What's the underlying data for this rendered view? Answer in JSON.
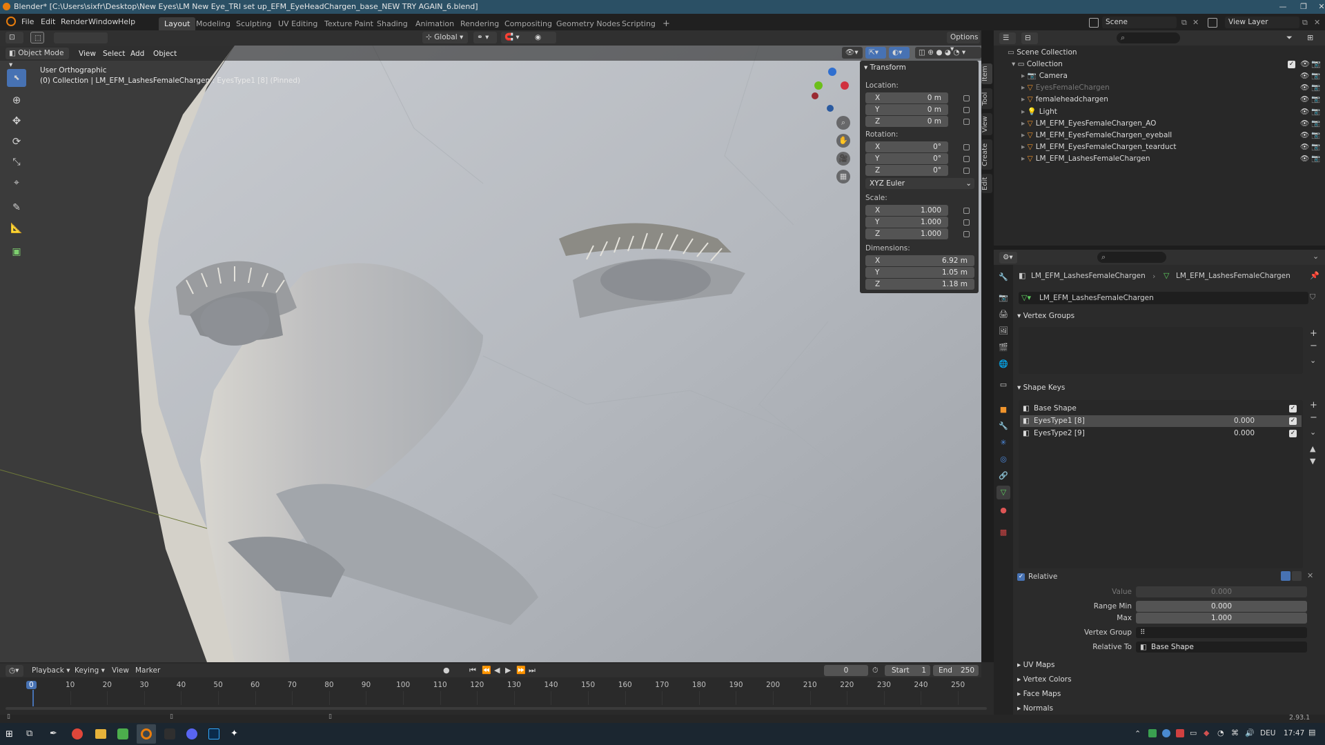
{
  "window": {
    "title": "Blender* [C:\\Users\\sixfr\\Desktop\\New Eyes\\LM New Eye_TRI set up_EFM_EyeHeadChargen_base_NEW TRY AGAIN_6.blend]"
  },
  "menu": [
    "File",
    "Edit",
    "Render",
    "Window",
    "Help"
  ],
  "workspaces": [
    "Layout",
    "Modeling",
    "Sculpting",
    "UV Editing",
    "Texture Paint",
    "Shading",
    "Animation",
    "Rendering",
    "Compositing",
    "Geometry Nodes",
    "Scripting"
  ],
  "scene": {
    "label": "Scene",
    "view_layer": "View Layer"
  },
  "viewport": {
    "mode": "Object Mode",
    "menus": [
      "View",
      "Select",
      "Add",
      "Object"
    ],
    "transform_orient": "Global",
    "options": "Options",
    "view_name": "User Orthographic",
    "context": "(0) Collection | LM_EFM_LashesFemaleChargen : EyesType1 [8] (Pinned)"
  },
  "npanel": {
    "title": "Transform",
    "tabs": [
      "Item",
      "Tool",
      "View",
      "Create",
      "Edit"
    ],
    "location_label": "Location:",
    "rotation_label": "Rotation:",
    "scale_label": "Scale:",
    "dimensions_label": "Dimensions:",
    "location": [
      {
        "k": "X",
        "v": "0 m"
      },
      {
        "k": "Y",
        "v": "0 m"
      },
      {
        "k": "Z",
        "v": "0 m"
      }
    ],
    "rotation": [
      {
        "k": "X",
        "v": "0°"
      },
      {
        "k": "Y",
        "v": "0°"
      },
      {
        "k": "Z",
        "v": "0°"
      }
    ],
    "rotation_mode": "XYZ Euler",
    "scale": [
      {
        "k": "X",
        "v": "1.000"
      },
      {
        "k": "Y",
        "v": "1.000"
      },
      {
        "k": "Z",
        "v": "1.000"
      }
    ],
    "dimensions": [
      {
        "k": "X",
        "v": "6.92 m"
      },
      {
        "k": "Y",
        "v": "1.05 m"
      },
      {
        "k": "Z",
        "v": "1.18 m"
      }
    ]
  },
  "outliner": {
    "root": "Scene Collection",
    "collection": "Collection",
    "items": [
      {
        "name": "Camera",
        "icon": "camera-icon"
      },
      {
        "name": "EyesFemaleChargen",
        "icon": "mesh-icon",
        "dim": true
      },
      {
        "name": "femaleheadchargen",
        "icon": "mesh-icon"
      },
      {
        "name": "Light",
        "icon": "light-icon"
      },
      {
        "name": "LM_EFM_EyesFemaleChargen_AO",
        "icon": "mesh-icon"
      },
      {
        "name": "LM_EFM_EyesFemaleChargen_eyeball",
        "icon": "mesh-icon"
      },
      {
        "name": "LM_EFM_EyesFemaleChargen_tearduct",
        "icon": "mesh-icon"
      },
      {
        "name": "LM_EFM_LashesFemaleChargen",
        "icon": "mesh-icon"
      }
    ]
  },
  "props": {
    "object": "LM_EFM_LashesFemaleChargen",
    "mesh": "LM_EFM_LashesFemaleChargen",
    "mesh_field": "LM_EFM_LashesFemaleChargen",
    "vertex_groups": "Vertex Groups",
    "shape_keys": "Shape Keys",
    "keys": [
      {
        "name": "Base Shape",
        "value": ""
      },
      {
        "name": "EyesType1 [8]",
        "value": "0.000"
      },
      {
        "name": "EyesType2 [9]",
        "value": "0.000"
      }
    ],
    "relative": "Relative",
    "value_label": "Value",
    "value": "0.000",
    "range_min_label": "Range Min",
    "range_min": "0.000",
    "max_label": "Max",
    "max": "1.000",
    "vgroup_label": "Vertex Group",
    "relative_to_label": "Relative To",
    "relative_to": "Base Shape",
    "collapsed": [
      "UV Maps",
      "Vertex Colors",
      "Face Maps",
      "Normals"
    ]
  },
  "timeline": {
    "menus": [
      "Playback",
      "Keying",
      "View",
      "Marker"
    ],
    "current": "0",
    "start_label": "Start",
    "start": "1",
    "end_label": "End",
    "end": "250",
    "ticks": [
      "0",
      "10",
      "20",
      "30",
      "40",
      "50",
      "60",
      "70",
      "80",
      "90",
      "100",
      "110",
      "120",
      "130",
      "140",
      "150",
      "160",
      "170",
      "180",
      "190",
      "200",
      "210",
      "220",
      "230",
      "240",
      "250"
    ]
  },
  "status": {
    "version": "2.93.1"
  },
  "taskbar": {
    "lang": "DEU",
    "time": "17:47"
  }
}
